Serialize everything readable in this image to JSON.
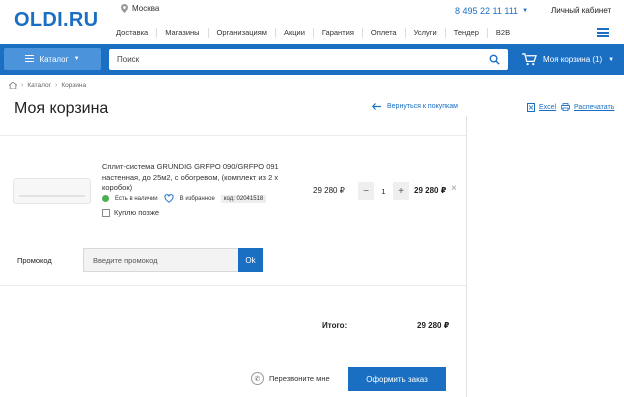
{
  "header": {
    "logo": "OLDI.RU",
    "city": "Москва",
    "phone": "8 495 22 11 111",
    "account": "Личный кабинет",
    "nav": [
      "Доставка",
      "Магазины",
      "Организациям",
      "Акции",
      "Гарантия",
      "Оплета",
      "Услуги",
      "Тендер",
      "B2B"
    ]
  },
  "bar": {
    "catalog_label": "Каталог",
    "search_placeholder": "Поиск",
    "cart_label": "Моя корзина (1)"
  },
  "breadcrumbs": [
    "Каталог",
    "Корзина"
  ],
  "page": {
    "title": "Моя корзина",
    "back_link": "Вернуться к покупкам",
    "excel_link": "Excel",
    "print_link": "Распечатать"
  },
  "item": {
    "name": "Сплит-система GRUNDIG GRFPO 090/GRFPO 091 настенная, до 25м2, с обогревом, (комплект из 2 х коробок)",
    "availability": "Есть в наличии",
    "favorites": "В избранное",
    "code": "код: 02041518",
    "buy_later": "Куплю позже",
    "price": "29 280 ₽",
    "quantity": "1",
    "minus": "−",
    "plus": "+",
    "total": "29 280 ₽",
    "remove": "×"
  },
  "promo": {
    "label": "Промокод",
    "placeholder": "Введите промокод",
    "button": "Ok"
  },
  "summary": {
    "total_label": "Итого:",
    "total_value": "29 280 ₽",
    "callback": "Перезвоните мне",
    "order_button": "Оформить заказ"
  },
  "colors": {
    "brand": "#1b6fc3",
    "in_stock": "#4caf50"
  }
}
